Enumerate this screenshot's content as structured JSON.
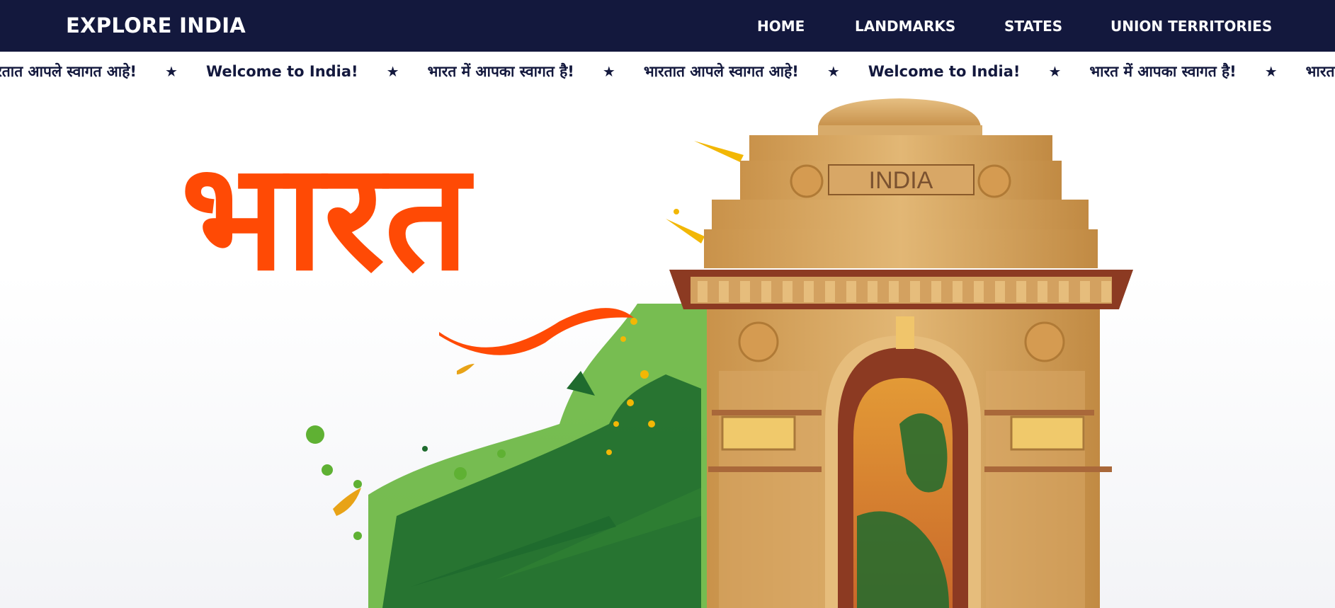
{
  "navbar": {
    "brand": "EXPLORE INDIA",
    "links": [
      "HOME",
      "LANDMARKS",
      "STATES",
      "UNION TERRITORIES"
    ],
    "background": "#13183d"
  },
  "ticker": {
    "items": [
      "भारतात आपले स्वागत आहे!",
      "Welcome to India!",
      "भारत में आपका स्वागत है!",
      "भारतात आपले स्वागत आहे!",
      "Welcome to India!",
      "भारत में आपका स्वागत है!",
      "भारतात आपले स्वागत आहे!"
    ],
    "separator_icon": "star-icon",
    "separator": "★"
  },
  "hero": {
    "title": "भारत",
    "monument_inscription": "INDIA",
    "title_color": "#ff4a05",
    "monument_color": "#d4a25a",
    "splash_colors": [
      "#1f6b2e",
      "#5fb133",
      "#f2b705"
    ]
  }
}
